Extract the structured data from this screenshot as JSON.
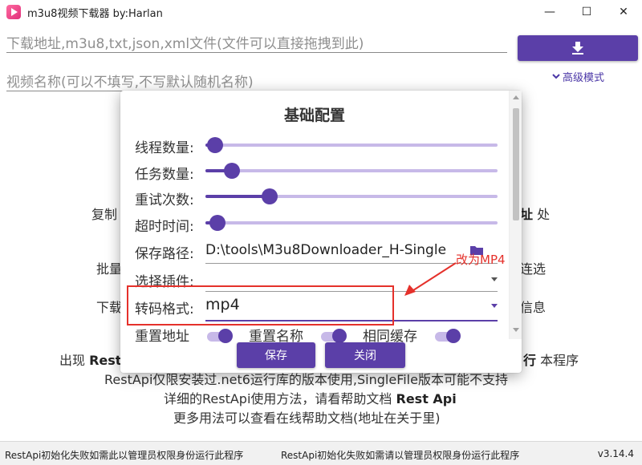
{
  "window": {
    "title": "m3u8视频下载器 by:Harlan",
    "minimize_label": "—",
    "maximize_label": "☐",
    "close_label": "✕"
  },
  "main": {
    "url_placeholder": "下载地址,m3u8,txt,json,xml文件(文件可以直接拖拽到此)",
    "name_placeholder": "视频名称(可以不填写,不写默认随机名称)",
    "advanced_mode_label": "高级模式",
    "bg_lines": {
      "copy_left": "复制",
      "copy_right_bold": "址",
      "copy_right": "处",
      "batch_left": "批量",
      "batch_right": "连选",
      "download_left": "下载",
      "download_right": "信息",
      "error_prefix": "出现 ",
      "error_bold_left": "Rest",
      "error_bold_right": "行",
      "error_suffix": " 本程序",
      "restapi_note": "RestApi仅限安装过.net6运行库的版本使用,SingleFile版本可能不支持",
      "help_prefix": "详细的RestApi使用方法，请看帮助文档 ",
      "help_bold": "Rest Api",
      "more_usage": "更多用法可以查看在线帮助文档(地址在关于里)"
    }
  },
  "dialog": {
    "title": "基础配置",
    "sliders": [
      {
        "label": "线程数量:",
        "value_fraction": 0.03
      },
      {
        "label": "任务数量:",
        "value_fraction": 0.09
      },
      {
        "label": "重试次数:",
        "value_fraction": 0.22
      },
      {
        "label": "超时时间:",
        "value_fraction": 0.04
      }
    ],
    "save_path_label": "保存路径:",
    "save_path_value": "D:\\tools\\M3u8Downloader_H-Single",
    "plugin_label": "选择插件:",
    "format_label": "转码格式:",
    "format_value": "mp4",
    "toggles": [
      {
        "label": "重置地址",
        "on": true
      },
      {
        "label": "重置名称",
        "on": true
      },
      {
        "label": "相同缓存",
        "on": true
      }
    ],
    "save_button": "保存",
    "close_button": "关闭"
  },
  "annotation": {
    "text": "改为MP4",
    "color": "#e5312b"
  },
  "statusbar": {
    "left": "RestApi初始化失败如需此以管理员权限身份运行此程序",
    "center": "RestApi初始化失败如需请以管理员权限身份运行此程序",
    "version": "v3.14.4"
  },
  "colors": {
    "accent": "#5b3fa8",
    "accent_light": "#c7b9e8"
  }
}
